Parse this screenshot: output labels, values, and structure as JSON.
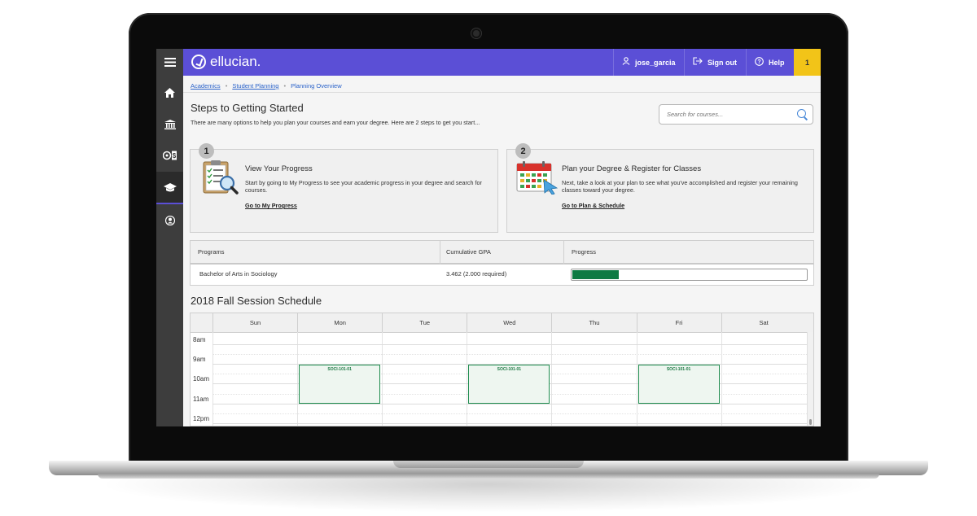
{
  "app": {
    "brand": "ellucian.",
    "user": "jose_garcia",
    "signout_label": "Sign out",
    "help_label": "Help",
    "notification_count": "1",
    "accent_color": "#5b4fd6"
  },
  "sidebar": {
    "items": [
      {
        "name": "menu-icon",
        "glyph": "≡"
      },
      {
        "name": "home-icon",
        "glyph": "⌂"
      },
      {
        "name": "institution-icon",
        "glyph": "🏛"
      },
      {
        "name": "finance-icon",
        "glyph": "$"
      },
      {
        "name": "graduation-cap-icon",
        "glyph": "🎓"
      },
      {
        "name": "user-icon",
        "glyph": "●"
      }
    ]
  },
  "breadcrumb": {
    "items": [
      "Academics",
      "Student Planning",
      "Planning Overview"
    ]
  },
  "header": {
    "title": "Steps to Getting Started",
    "subtitle": "There are many options to help you plan your courses and earn your degree. Here are 2 steps to get you start...",
    "search_placeholder": "Search for courses..."
  },
  "steps": [
    {
      "number": "1",
      "title": "View Your Progress",
      "description": "Start by going to My Progress to see your academic progress in your degree and search for courses.",
      "link": "Go to My Progress"
    },
    {
      "number": "2",
      "title": "Plan your Degree & Register for Classes",
      "description": "Next, take a look at your plan to see what you've accomplished and register your remaining classes toward your degree.",
      "link": "Go to Plan & Schedule"
    }
  ],
  "programs": {
    "headers": [
      "Programs",
      "Cumulative GPA",
      "Progress"
    ],
    "rows": [
      {
        "program": "Bachelor of Arts in Sociology",
        "gpa": "3.462 (2.000 required)",
        "progress": 0.2
      }
    ]
  },
  "schedule": {
    "title": "2018 Fall Session Schedule",
    "days": [
      "Sun",
      "Mon",
      "Tue",
      "Wed",
      "Thu",
      "Fri",
      "Sat"
    ],
    "times": [
      "8am",
      "9am",
      "10am",
      "11am",
      "12pm"
    ],
    "events": [
      {
        "label": "SOCI-101-01",
        "day": "Mon",
        "start": "9am",
        "end": "11am"
      },
      {
        "label": "SOCI-101-01",
        "day": "Wed",
        "start": "9am",
        "end": "11am"
      },
      {
        "label": "SOCI-101-01",
        "day": "Fri",
        "start": "9am",
        "end": "11am"
      }
    ],
    "event_color": "#1e8c4e"
  }
}
